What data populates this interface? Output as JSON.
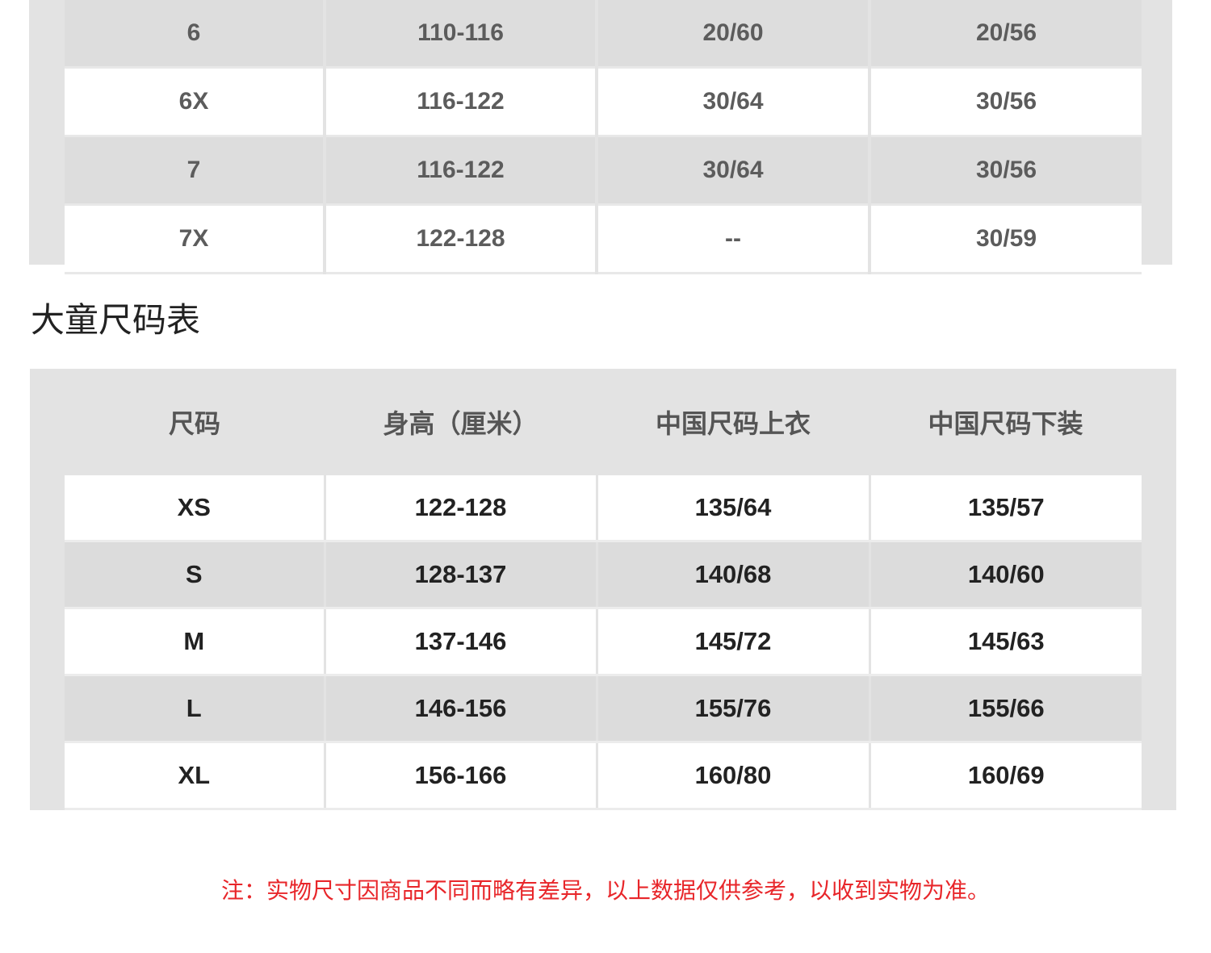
{
  "top_table": {
    "rows": [
      [
        "6",
        "110-116",
        "20/60",
        "20/56"
      ],
      [
        "6X",
        "116-122",
        "30/64",
        "30/56"
      ],
      [
        "7",
        "116-122",
        "30/64",
        "30/56"
      ],
      [
        "7X",
        "122-128",
        "--",
        "30/59"
      ]
    ]
  },
  "big_kids": {
    "title": "大童尺码表",
    "headers": [
      "尺码",
      "身高（厘米）",
      "中国尺码上衣",
      "中国尺码下装"
    ],
    "rows": [
      [
        "XS",
        "122-128",
        "135/64",
        "135/57"
      ],
      [
        "S",
        "128-137",
        "140/68",
        "140/60"
      ],
      [
        "M",
        "137-146",
        "145/72",
        "145/63"
      ],
      [
        "L",
        "146-156",
        "155/76",
        "155/66"
      ],
      [
        "XL",
        "156-166",
        "160/80",
        "160/69"
      ]
    ]
  },
  "note": "注：实物尺寸因商品不同而略有差异，以上数据仅供参考，以收到实物为准。",
  "colors": {
    "panel_gray": "#e3e3e3",
    "row_gray": "#dcdcdc",
    "note_red": "#e8262a"
  }
}
